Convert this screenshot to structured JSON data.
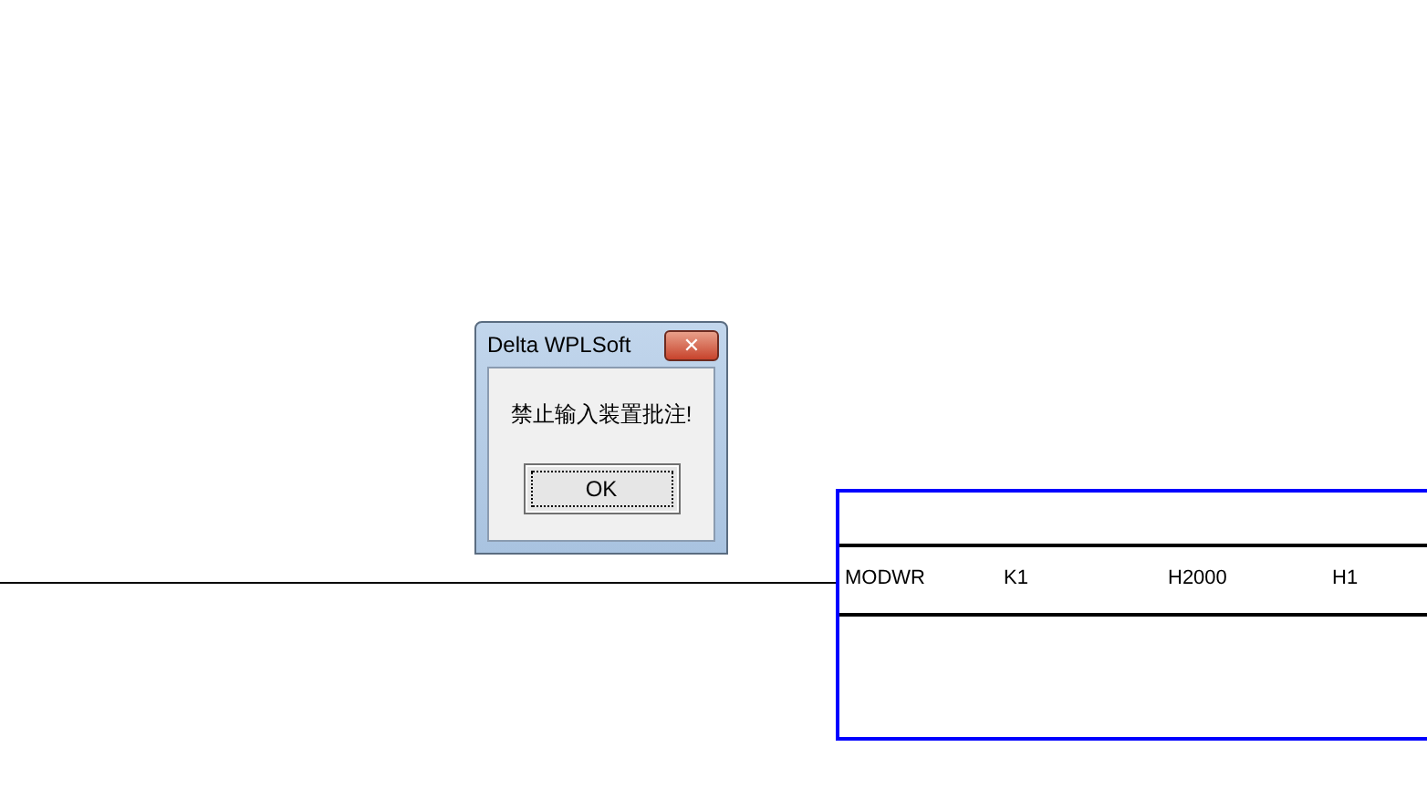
{
  "dialog": {
    "title": "Delta WPLSoft",
    "close_symbol": "✕",
    "message": "禁止输入装置批注!",
    "button": "OK"
  },
  "instruction": {
    "cells": [
      "MODWR",
      "K1",
      "H2000",
      "H1"
    ]
  }
}
